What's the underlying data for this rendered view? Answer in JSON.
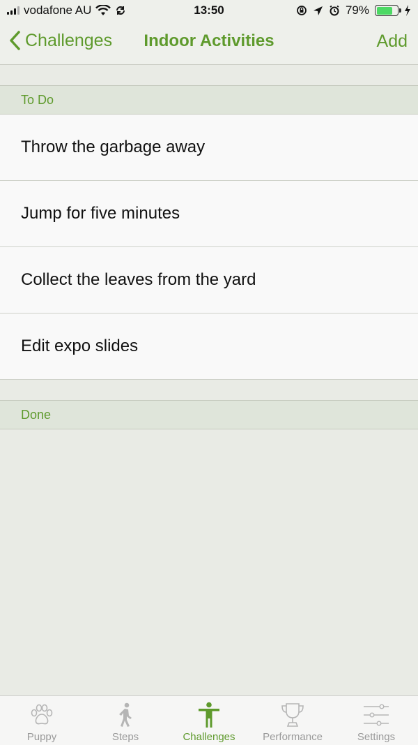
{
  "status": {
    "carrier": "vodafone AU",
    "time": "13:50",
    "battery": "79%"
  },
  "nav": {
    "back_label": "Challenges",
    "title": "Indoor Activities",
    "add_label": "Add"
  },
  "sections": {
    "todo_header": "To Do",
    "done_header": "Done"
  },
  "todo_items": [
    "Throw the garbage away",
    "Jump for five minutes",
    "Collect the leaves from the yard",
    "Edit expo slides"
  ],
  "tabs": [
    {
      "label": "Puppy",
      "icon": "paw-icon"
    },
    {
      "label": "Steps",
      "icon": "walking-icon"
    },
    {
      "label": "Challenges",
      "icon": "person-icon"
    },
    {
      "label": "Performance",
      "icon": "trophy-icon"
    },
    {
      "label": "Settings",
      "icon": "sliders-icon"
    }
  ],
  "colors": {
    "accent": "#5e9a2c",
    "inactive": "#9a9a9a",
    "battery_fill": "#4cd964"
  }
}
